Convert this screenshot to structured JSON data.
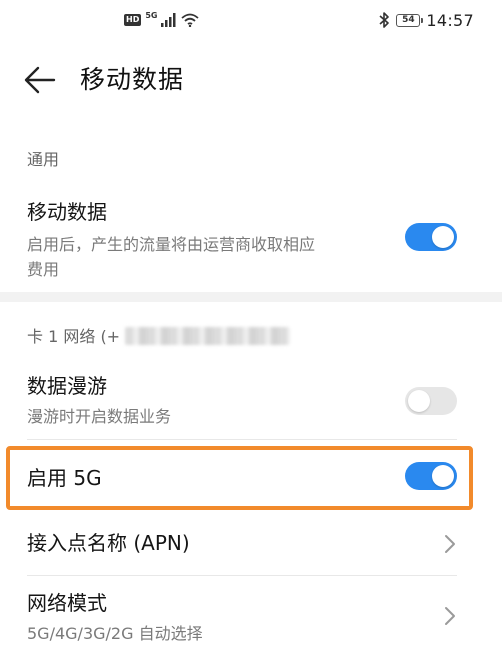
{
  "status_bar": {
    "hd_badge": "HD",
    "network_type": "5G",
    "battery_level": "54",
    "time": "14:57"
  },
  "header": {
    "title": "移动数据"
  },
  "section_general": {
    "label": "通用"
  },
  "mobile_data": {
    "title": "移动数据",
    "subtitle_line1": "启用后，产生的流量将由运营商收取相应",
    "subtitle_line2": "费用",
    "enabled": true
  },
  "section_sim1": {
    "label": "卡 1 网络 (+"
  },
  "data_roaming": {
    "title": "数据漫游",
    "subtitle": "漫游时开启数据业务",
    "enabled": false
  },
  "enable_5g": {
    "title": "启用 5G",
    "enabled": true
  },
  "apn": {
    "title": "接入点名称 (APN)"
  },
  "network_mode": {
    "title": "网络模式",
    "subtitle": "5G/4G/3G/2G 自动选择"
  },
  "colors": {
    "accent": "#2a89ef",
    "highlight": "#f28a2b"
  }
}
